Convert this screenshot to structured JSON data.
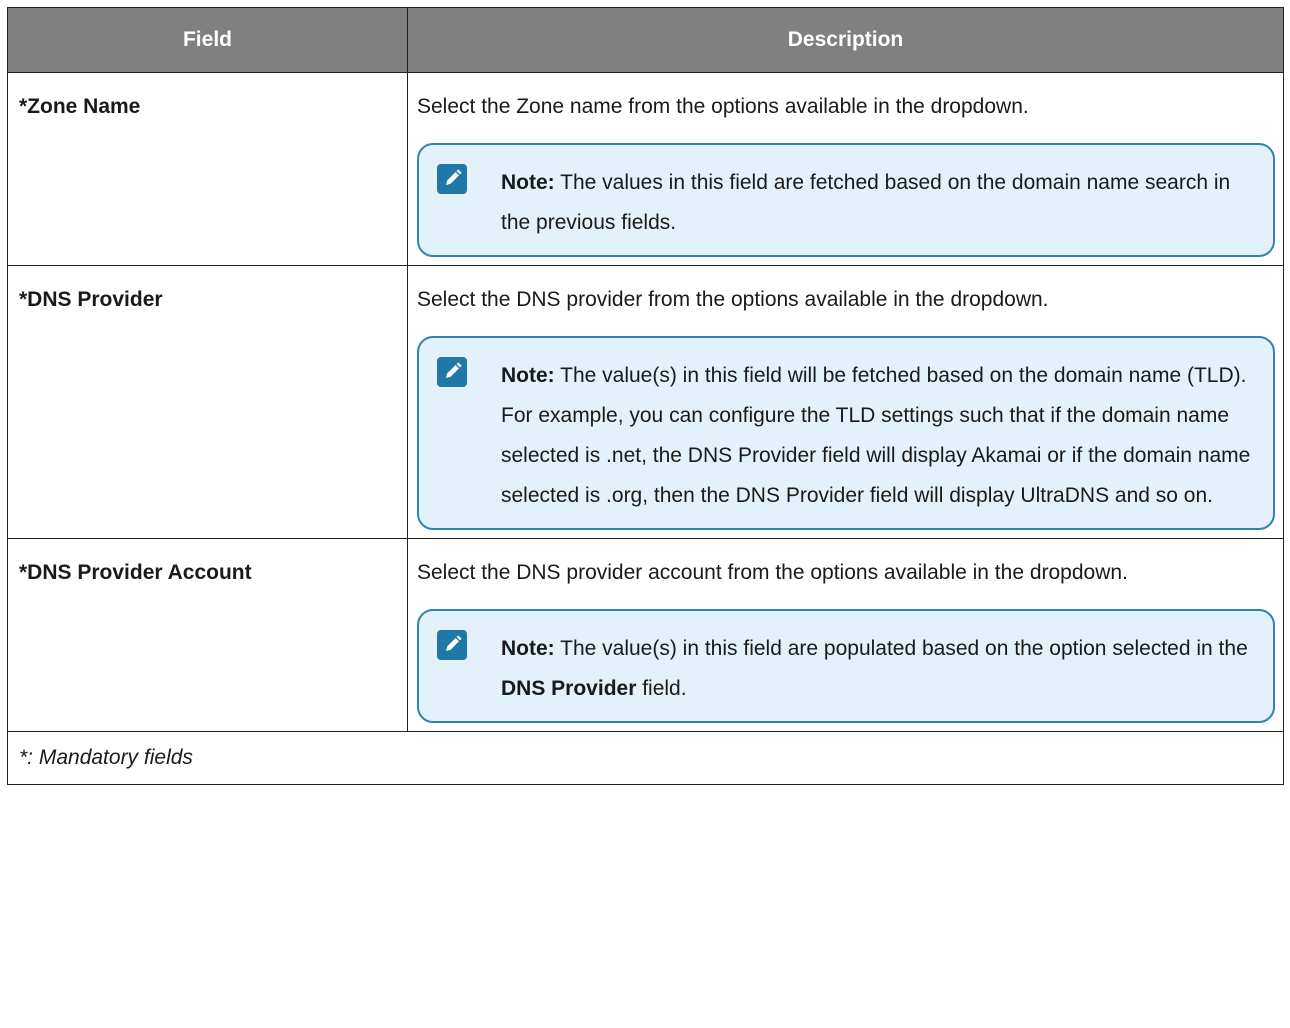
{
  "table": {
    "headers": {
      "field": "Field",
      "description": "Description"
    },
    "rows": [
      {
        "field": "*Zone Name",
        "description": "Select the Zone name from the options available in the dropdown.",
        "note": {
          "icon": "pencil-note-icon",
          "label": "Note:",
          "text": " The values in this field are fetched based on the domain name search in the previous fields."
        }
      },
      {
        "field": "*DNS Provider",
        "description": "Select the DNS provider from the options available in the dropdown.",
        "note": {
          "icon": "pencil-note-icon",
          "label": "Note:",
          "text": " The value(s) in this field will be fetched based on the domain name (TLD). For example, you can configure the TLD settings such that if the domain name selected is .net, the DNS Provider field will display Akamai or if the domain name selected is .org, then the DNS Provider field will display UltraDNS and so on."
        }
      },
      {
        "field": "*DNS Provider Account",
        "description": "Select the DNS provider account from the options available in the dropdown.",
        "note": {
          "icon": "pencil-note-icon",
          "label": "Note:",
          "text_before": " The value(s) in this field are populated based on the option selected in the ",
          "bold": "DNS Provider",
          "text_after": " field."
        }
      }
    ],
    "footer": "*: Mandatory fields"
  },
  "colors": {
    "header_bg": "#808080",
    "note_bg": "#e3f1fa",
    "note_border": "#2f84b2",
    "icon": "#1f78a8"
  }
}
